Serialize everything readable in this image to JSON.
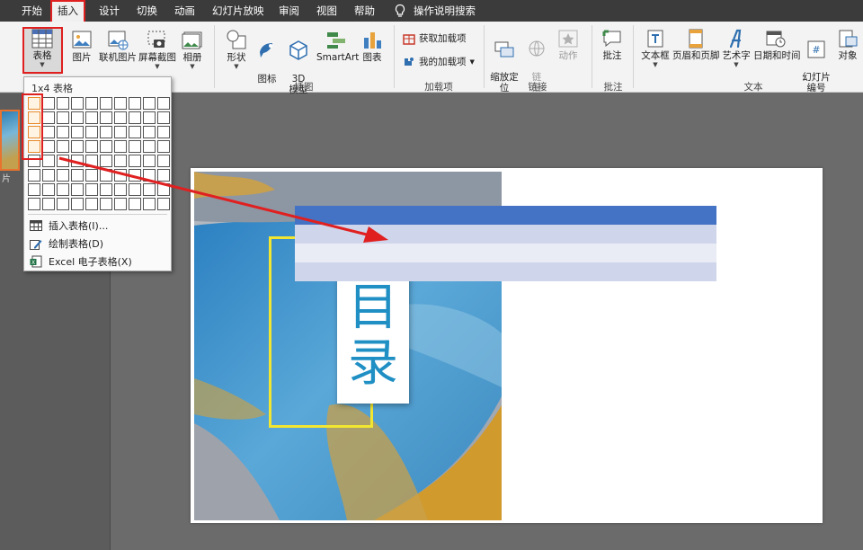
{
  "menubar": {
    "tabs": [
      {
        "label": "开始"
      },
      {
        "label": "插入",
        "active": true
      },
      {
        "label": "设计"
      },
      {
        "label": "切换"
      },
      {
        "label": "动画"
      },
      {
        "label": "幻灯片放映"
      },
      {
        "label": "审阅"
      },
      {
        "label": "视图"
      },
      {
        "label": "帮助"
      },
      {
        "label": "操作说明搜索"
      }
    ]
  },
  "ribbon": {
    "table": "表格",
    "picture": "图片",
    "online_picture": "联机图片",
    "screenshot": "屏幕截图",
    "album": "相册",
    "shapes": "形状",
    "icons": "图标",
    "model3d": "3D\n模型",
    "smartart": "SmartArt",
    "chart": "图表",
    "get_addins": "获取加载项",
    "my_addins": "我的加载项",
    "zoom": "缩放定\n位",
    "link": "链\n接",
    "action": "动作",
    "comment": "批注",
    "textbox": "文本框",
    "header_footer": "页眉和页脚",
    "wordart": "艺术字",
    "datetime": "日期和时间",
    "slide_number": "幻灯片\n编号",
    "object": "对象",
    "groups": {
      "illustrations": "插图",
      "addins": "加载项",
      "links": "链接",
      "comments": "批注",
      "text": "文本"
    }
  },
  "left_panel": {
    "side_text": "片"
  },
  "dropdown": {
    "title": "1x4 表格",
    "rows": 8,
    "cols": 10,
    "highlight_rows": 4,
    "highlight_cols": 1,
    "items": [
      {
        "label": "插入表格(I)..."
      },
      {
        "label": "绘制表格(D)"
      },
      {
        "label": "Excel 电子表格(X)"
      }
    ]
  },
  "slide": {
    "title_chars": [
      "目",
      "录"
    ],
    "table_rows": [
      {
        "color": "#4472c4"
      },
      {
        "color": "#cfd5ea"
      },
      {
        "color": "#e9ebf5"
      },
      {
        "color": "#cfd5ea"
      }
    ]
  },
  "colors": {
    "accent_red": "#e02020",
    "title_blue": "#1f8fc4",
    "frame_yellow": "#f2e631"
  }
}
